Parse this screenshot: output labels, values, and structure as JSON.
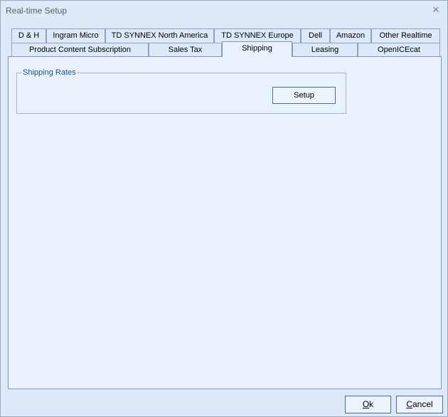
{
  "window": {
    "title": "Real-time Setup"
  },
  "tabs": {
    "row1": [
      {
        "label": "D & H"
      },
      {
        "label": "Ingram Micro"
      },
      {
        "label": "TD SYNNEX North America"
      },
      {
        "label": "TD SYNNEX Europe"
      },
      {
        "label": "Dell"
      },
      {
        "label": "Amazon"
      },
      {
        "label": "Other Realtime"
      }
    ],
    "row2": [
      {
        "label": "Product Content Subscription"
      },
      {
        "label": "Sales Tax"
      },
      {
        "label": "Shipping"
      },
      {
        "label": "Leasing"
      },
      {
        "label": "OpenICEcat"
      }
    ],
    "active": "Shipping"
  },
  "shipping": {
    "group_label": "Shipping Rates",
    "setup_label": "Setup"
  },
  "footer": {
    "ok_mnemonic": "O",
    "ok_rest": "k",
    "cancel_mnemonic": "C",
    "cancel_rest": "ancel"
  }
}
